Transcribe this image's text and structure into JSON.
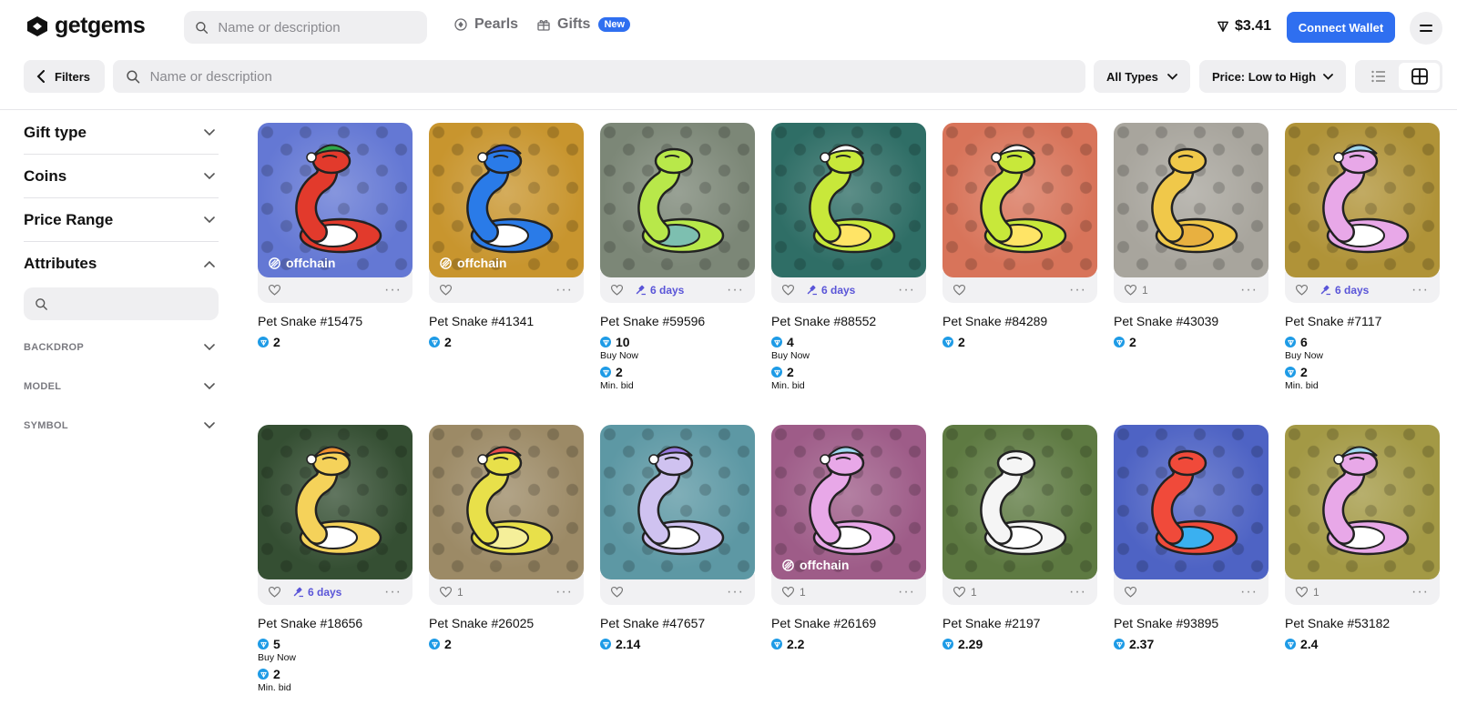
{
  "brand": {
    "name": "getgems"
  },
  "header": {
    "search_placeholder": "Name or description",
    "nav": [
      {
        "label": "Pearls",
        "icon": "pearl-icon"
      },
      {
        "label": "Gifts",
        "icon": "gift-icon",
        "badge": "New"
      }
    ],
    "balance": "$3.41",
    "connect_label": "Connect Wallet"
  },
  "toolbar": {
    "filters_label": "Filters",
    "search_placeholder": "Name or description",
    "type_filter": "All Types",
    "sort": "Price: Low to High"
  },
  "sidebar": {
    "sections": [
      "Gift type",
      "Coins",
      "Price Range",
      "Attributes"
    ],
    "attributes": [
      "BACKDROP",
      "MODEL",
      "SYMBOL"
    ]
  },
  "colors": {
    "accent": "#2f6ff0",
    "ton": "#1e9be6",
    "bid": "#5a55d8"
  },
  "cards": [
    {
      "name": "Pet Snake #15475",
      "price": "2",
      "bg": "#6478d4",
      "offchain": "offchain",
      "likes": "",
      "bid_days": "",
      "body": "#e23a2c",
      "belly": "#ffffff",
      "hat": "#2fa84a"
    },
    {
      "name": "Pet Snake #41341",
      "price": "2",
      "bg": "#c8952e",
      "offchain": "offchain",
      "likes": "",
      "bid_days": "",
      "body": "#2a7be8",
      "belly": "#ffffff",
      "hat": "#2a55d0"
    },
    {
      "name": "Pet Snake #59596",
      "price": "10",
      "buy_label": "Buy Now",
      "min_bid": "2",
      "min_label": "Min. bid",
      "bg": "#7c8777",
      "offchain": "",
      "likes": "",
      "bid_days": "6 days",
      "body": "#b8e84a",
      "belly": "#7dbfb0",
      "hat": ""
    },
    {
      "name": "Pet Snake #88552",
      "price": "4",
      "buy_label": "Buy Now",
      "min_bid": "2",
      "min_label": "Min. bid",
      "bg": "#2f6e66",
      "offchain": "",
      "likes": "",
      "bid_days": "6 days",
      "body": "#c8e83a",
      "belly": "#ffe466",
      "hat": "#ffffff"
    },
    {
      "name": "Pet Snake #84289",
      "price": "2",
      "bg": "#d8745a",
      "offchain": "",
      "likes": "",
      "bid_days": "",
      "body": "#c8e83a",
      "belly": "#ffe466",
      "hat": "#ffffff"
    },
    {
      "name": "Pet Snake #43039",
      "price": "2",
      "bg": "#a8a59d",
      "offchain": "",
      "likes": "1",
      "bid_days": "",
      "body": "#f0c84a",
      "belly": "#e8b040",
      "hat": ""
    },
    {
      "name": "Pet Snake #7117",
      "price": "6",
      "buy_label": "Buy Now",
      "min_bid": "2",
      "min_label": "Min. bid",
      "bg": "#b09338",
      "offchain": "",
      "likes": "",
      "bid_days": "6 days",
      "body": "#e8a8e8",
      "belly": "#ffffff",
      "hat": "#9fd8f0"
    },
    {
      "name": "Pet Snake #18656",
      "price": "5",
      "buy_label": "Buy Now",
      "min_bid": "2",
      "min_label": "Min. bid",
      "bg": "#354f33",
      "offchain": "",
      "likes": "",
      "bid_days": "6 days",
      "body": "#f5d25a",
      "belly": "#ffffff",
      "hat": "#f09030"
    },
    {
      "name": "Pet Snake #26025",
      "price": "2",
      "bg": "#9c8a66",
      "offchain": "",
      "likes": "1",
      "bid_days": "",
      "body": "#e8e04a",
      "belly": "#f5ef9a",
      "hat": "#e84a4a"
    },
    {
      "name": "Pet Snake #47657",
      "price": "2.14",
      "bg": "#5d98a4",
      "offchain": "",
      "likes": "",
      "bid_days": "",
      "body": "#cfc2f0",
      "belly": "#ffffff",
      "hat": "#9878e0"
    },
    {
      "name": "Pet Snake #26169",
      "price": "2.2",
      "bg": "#9e5c88",
      "offchain": "offchain",
      "likes": "1",
      "bid_days": "",
      "body": "#e8a8e8",
      "belly": "#ffffff",
      "hat": "#9fd8f0"
    },
    {
      "name": "Pet Snake #2197",
      "price": "2.29",
      "bg": "#5e7a42",
      "offchain": "",
      "likes": "1",
      "bid_days": "",
      "body": "#f5f5f5",
      "belly": "#ffffff",
      "hat": ""
    },
    {
      "name": "Pet Snake #93895",
      "price": "2.37",
      "bg": "#4e63c4",
      "offchain": "",
      "likes": "",
      "bid_days": "",
      "body": "#f04a3a",
      "belly": "#3ab0f0",
      "hat": ""
    },
    {
      "name": "Pet Snake #53182",
      "price": "2.4",
      "bg": "#a39945",
      "offchain": "",
      "likes": "1",
      "bid_days": "",
      "body": "#e8a8e8",
      "belly": "#ffffff",
      "hat": "#9fd8f0"
    }
  ]
}
